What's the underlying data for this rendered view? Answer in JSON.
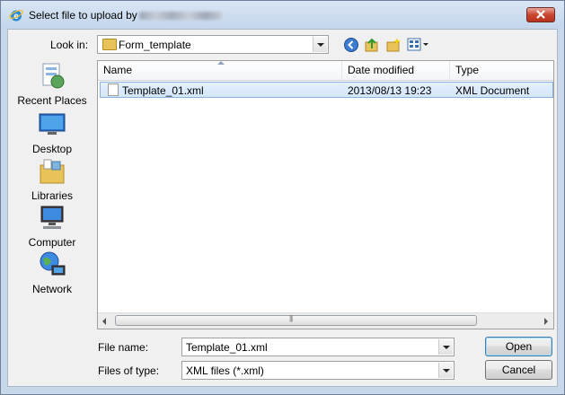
{
  "window": {
    "title": "Select file to upload by"
  },
  "lookin": {
    "label": "Look in:",
    "value": "Form_template"
  },
  "toolbar": {
    "icons": [
      "back-icon",
      "up-folder-icon",
      "new-folder-icon",
      "views-menu-icon"
    ]
  },
  "places": [
    {
      "label": "Recent Places",
      "icon": "recent-places-icon"
    },
    {
      "label": "Desktop",
      "icon": "desktop-icon"
    },
    {
      "label": "Libraries",
      "icon": "libraries-icon"
    },
    {
      "label": "Computer",
      "icon": "computer-icon"
    },
    {
      "label": "Network",
      "icon": "network-icon"
    }
  ],
  "filelist": {
    "columns": [
      "Name",
      "Date modified",
      "Type"
    ],
    "rows": [
      {
        "name": "Template_01.xml",
        "date": "2013/08/13 19:23",
        "type": "XML Document"
      }
    ]
  },
  "filename": {
    "label": "File name:",
    "value": "Template_01.xml"
  },
  "filetype": {
    "label": "Files of type:",
    "value": "XML files (*.xml)"
  },
  "buttons": {
    "open": "Open",
    "cancel": "Cancel"
  },
  "colors": {
    "selection": "#d3e6fa",
    "close_button": "#c9462f",
    "frame": "#c8d8ea"
  }
}
